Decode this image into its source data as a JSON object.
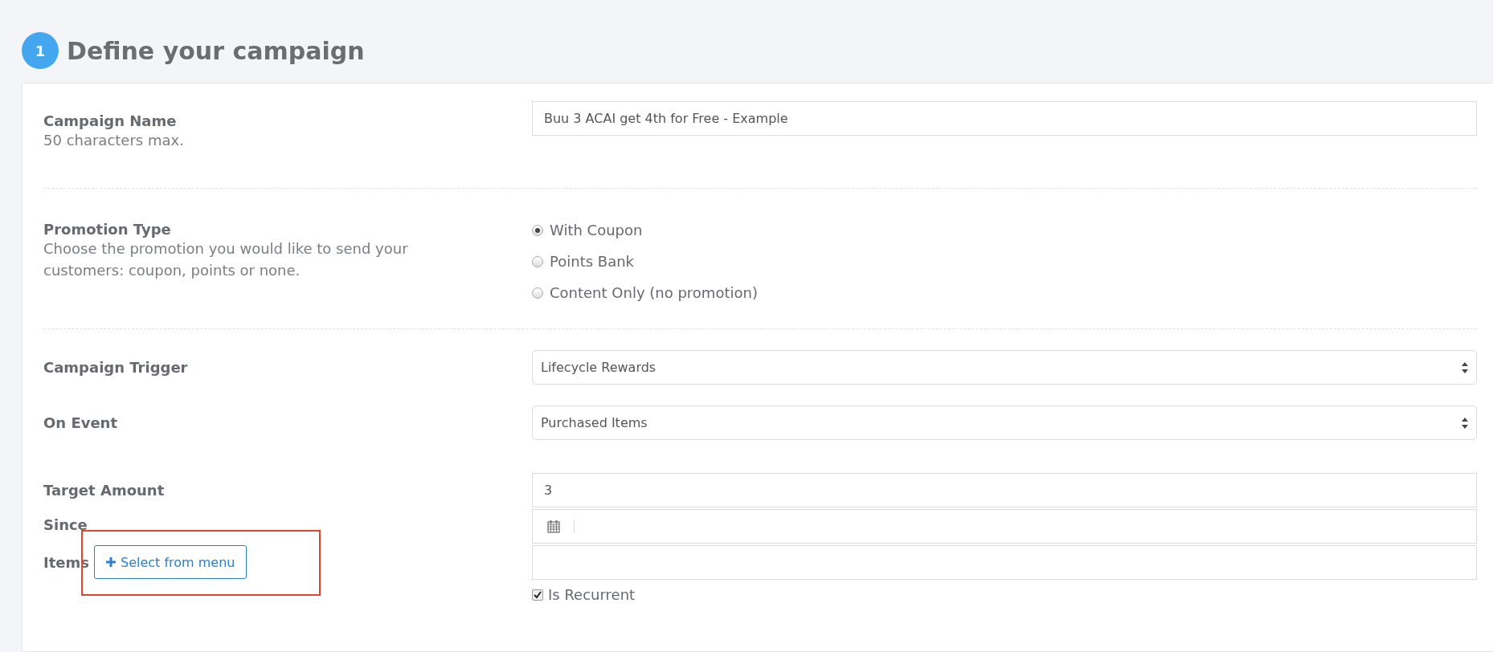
{
  "step": {
    "number": "1",
    "title": "Define your campaign"
  },
  "campaign_name": {
    "label": "Campaign Name",
    "hint": "50 characters max.",
    "value": "Buu 3 ACAI get 4th for Free - Example"
  },
  "promotion_type": {
    "label": "Promotion Type",
    "hint": "Choose the promotion you would like to send your customers: coupon, points or none.",
    "options": [
      {
        "label": "With Coupon",
        "selected": true
      },
      {
        "label": "Points Bank",
        "selected": false
      },
      {
        "label": "Content Only (no promotion)",
        "selected": false
      }
    ]
  },
  "campaign_trigger": {
    "label": "Campaign Trigger",
    "value": "Lifecycle Rewards"
  },
  "on_event": {
    "label": "On Event",
    "value": "Purchased Items"
  },
  "target_amount": {
    "label": "Target Amount",
    "value": "3"
  },
  "since": {
    "label": "Since"
  },
  "items": {
    "label": "Items",
    "button": "Select from menu",
    "highlighted": true
  },
  "is_recurrent": {
    "label": "Is Recurrent",
    "checked": true
  }
}
